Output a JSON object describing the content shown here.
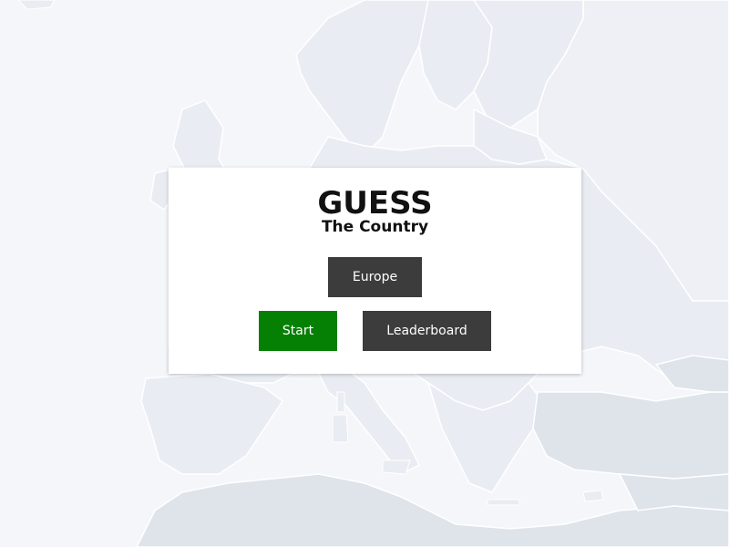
{
  "app": {
    "title": "GUESS",
    "subtitle": "The Country"
  },
  "menu": {
    "region_label": "Europe",
    "start_label": "Start",
    "leaderboard_label": "Leaderboard"
  },
  "colors": {
    "background": "#f3f5f9",
    "land": "#e8ebf1",
    "land_dark": "#dfe3ea",
    "border": "#ffffff",
    "panel": "#ffffff",
    "button_dark": "#3c3c3c",
    "button_start": "#058005",
    "text": "#111111"
  }
}
